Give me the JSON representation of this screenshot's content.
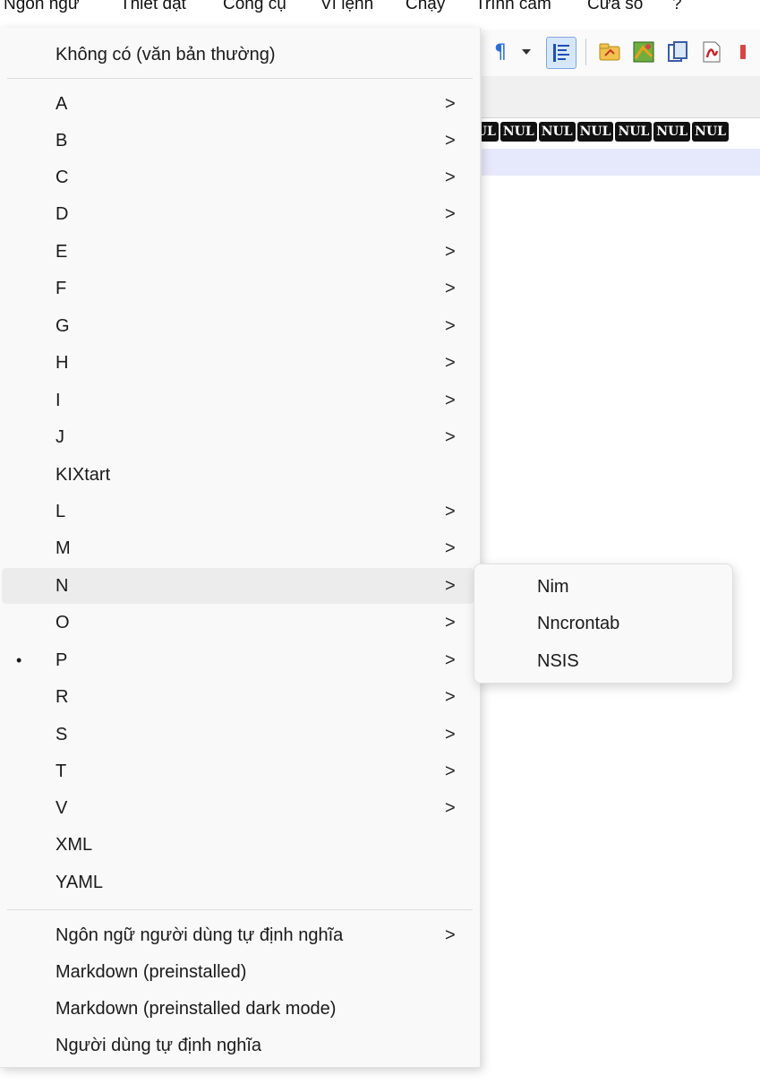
{
  "menubar": {
    "items": [
      "Ngôn ngữ",
      "Thiết đặt",
      "Công cụ",
      "Vĩ lệnh",
      "Chạy",
      "Trình cắm",
      "Cửa sổ",
      "?"
    ]
  },
  "editor": {
    "nul_tokens": [
      "NUL",
      "NUL",
      "NUL",
      "NUL",
      "NUL",
      "NUL",
      "NUL"
    ]
  },
  "toolbar": {
    "icons": [
      "pilcrow-icon",
      "dropdown-arrow-icon",
      "indent-guide-icon",
      "folder-icon",
      "map-icon",
      "clipboard-icon",
      "document-pdf-icon"
    ]
  },
  "language_menu": {
    "none_label": "Không có (văn bản thường)",
    "letters": [
      {
        "label": "A",
        "submenu": true
      },
      {
        "label": "B",
        "submenu": true
      },
      {
        "label": "C",
        "submenu": true
      },
      {
        "label": "D",
        "submenu": true
      },
      {
        "label": "E",
        "submenu": true
      },
      {
        "label": "F",
        "submenu": true
      },
      {
        "label": "G",
        "submenu": true
      },
      {
        "label": "H",
        "submenu": true
      },
      {
        "label": "I",
        "submenu": true
      },
      {
        "label": "J",
        "submenu": true
      },
      {
        "label": "KIXtart",
        "submenu": false
      },
      {
        "label": "L",
        "submenu": true
      },
      {
        "label": "M",
        "submenu": true
      },
      {
        "label": "N",
        "submenu": true,
        "highlighted": true
      },
      {
        "label": "O",
        "submenu": true
      },
      {
        "label": "P",
        "submenu": true,
        "checked": true
      },
      {
        "label": "R",
        "submenu": true
      },
      {
        "label": "S",
        "submenu": true
      },
      {
        "label": "T",
        "submenu": true
      },
      {
        "label": "V",
        "submenu": true
      },
      {
        "label": "XML",
        "submenu": false
      },
      {
        "label": "YAML",
        "submenu": false
      }
    ],
    "footer": [
      {
        "label": "Ngôn ngữ người dùng tự định nghĩa",
        "submenu": true
      },
      {
        "label": "Markdown (preinstalled)",
        "submenu": false
      },
      {
        "label": "Markdown (preinstalled dark mode)",
        "submenu": false
      },
      {
        "label": "Người dùng tự định nghĩa",
        "submenu": false
      }
    ],
    "arrow_glyph": ">",
    "bullet_glyph": "•"
  },
  "n_submenu": {
    "items": [
      "Nim",
      "Nncrontab",
      "NSIS"
    ]
  },
  "colors": {
    "menu_bg": "#f9f9f9",
    "hover_bg": "#ececec",
    "current_line": "#e6e8fb"
  }
}
